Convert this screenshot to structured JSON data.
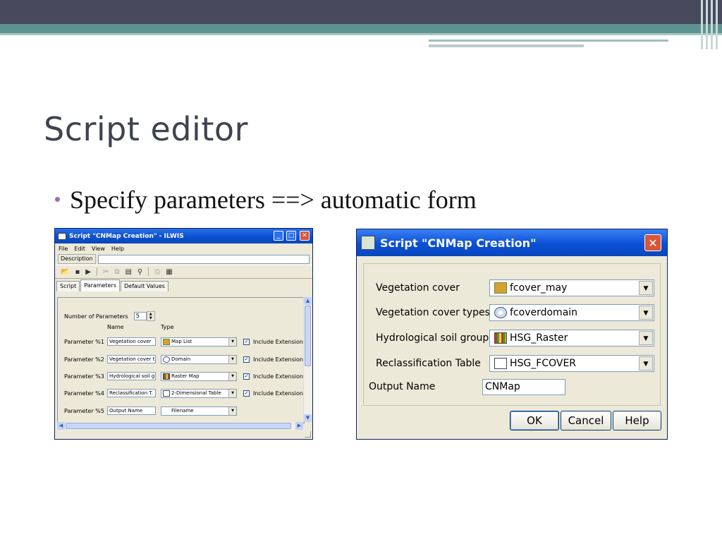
{
  "slide": {
    "title": "Script editor",
    "bullet": "Specify parameters ==> automatic form"
  },
  "editor_window": {
    "title": "Script \"CNMap Creation\" - ILWIS",
    "menu": [
      "File",
      "Edit",
      "View",
      "Help"
    ],
    "description_label": "Description",
    "description_value": "",
    "tabs": [
      "Script",
      "Parameters",
      "Default Values"
    ],
    "active_tab": "Parameters",
    "number_of_parameters_label": "Number of Parameters",
    "number_of_parameters": "5",
    "col_name": "Name",
    "col_type": "Type",
    "parameters": [
      {
        "label": "Parameter %1",
        "name": "Vegetation cover",
        "type": "Map List",
        "type_icon": "map-list-icon",
        "include_extension": true,
        "include_label": "Include Extension"
      },
      {
        "label": "Parameter %2",
        "name": "Vegetation cover t",
        "type": "Domain",
        "type_icon": "domain-icon",
        "include_extension": true,
        "include_label": "Include Extension"
      },
      {
        "label": "Parameter %3",
        "name": "Hydrological soil g",
        "type": "Raster Map",
        "type_icon": "raster-map-icon",
        "include_extension": true,
        "include_label": "Include Extension"
      },
      {
        "label": "Parameter %4",
        "name": "Reclassification T.",
        "type": "2-Dimensional Table",
        "type_icon": "table-icon",
        "include_extension": true,
        "include_label": "Include Extension"
      },
      {
        "label": "Parameter %5",
        "name": "Output Name",
        "type": "Filename",
        "type_icon": "",
        "include_extension": false,
        "include_label": ""
      }
    ]
  },
  "form_dialog": {
    "title": "Script \"CNMap Creation\"",
    "fields": [
      {
        "label": "Vegetation cover",
        "value": "fcover_may",
        "icon": "map-list-icon"
      },
      {
        "label": "Vegetation cover types",
        "value": "fcoverdomain",
        "icon": "domain-icon"
      },
      {
        "label": "Hydrological soil groups",
        "value": "HSG_Raster",
        "icon": "raster-map-icon"
      },
      {
        "label": "Reclassification Table",
        "value": "HSG_FCOVER",
        "icon": "table-icon"
      }
    ],
    "output_label": "Output Name",
    "output_value": "CNMap",
    "buttons": {
      "ok": "OK",
      "cancel": "Cancel",
      "help": "Help"
    }
  },
  "colors": {
    "titlebar": "#0a50d6",
    "close": "#d9553a",
    "window_bg": "#ece9d8",
    "slide_title": "#3f4350",
    "bullet_dot": "#9b6fae",
    "header_bar": "#464a5c",
    "teal": "#5e9490"
  }
}
